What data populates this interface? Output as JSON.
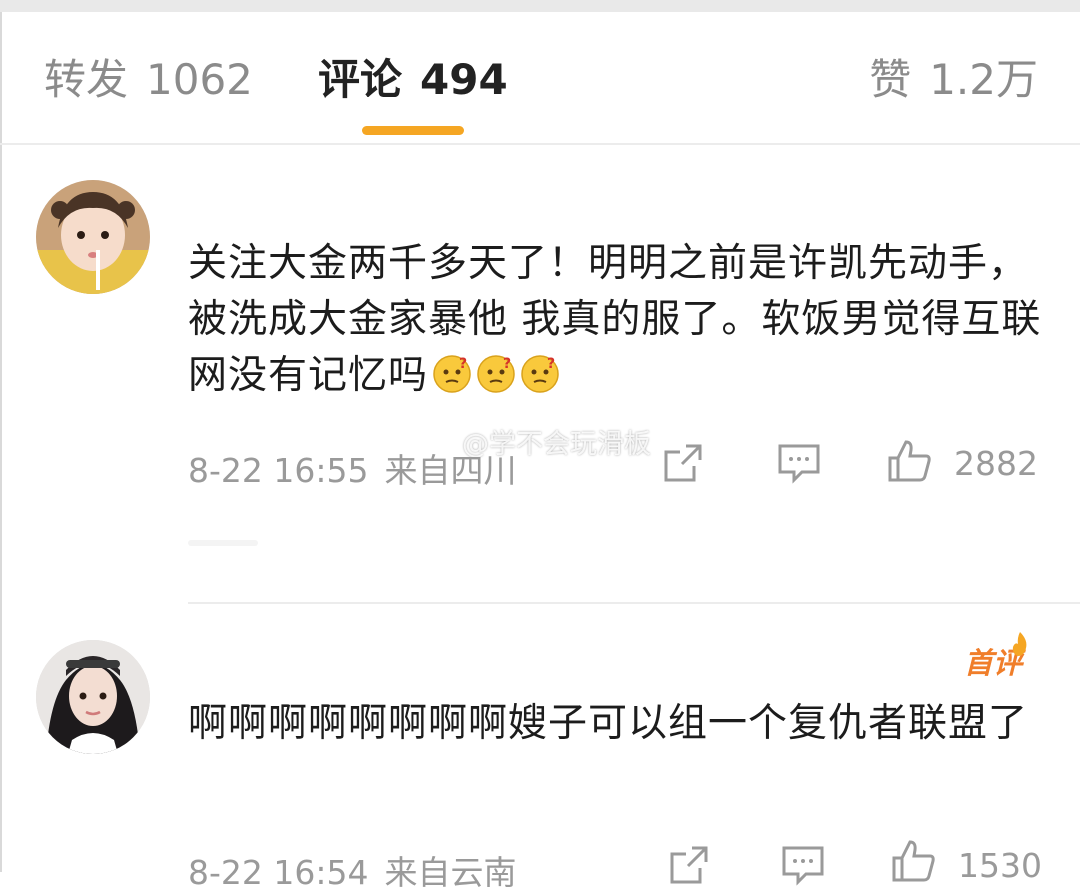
{
  "tabs": {
    "forward": {
      "label": "转发",
      "count": "1062"
    },
    "comments": {
      "label": "评论",
      "count": "494"
    },
    "likes": {
      "label": "赞",
      "count": "1.2万"
    },
    "active": "comments"
  },
  "comments": [
    {
      "text": "关注大金两千多天了！明明之前是许凯先动手，被洗成大金家暴他 我真的服了。软饭男觉得互联网没有记忆吗",
      "emojis": [
        "thinking-emoji",
        "thinking-emoji",
        "thinking-emoji"
      ],
      "time": "8-22 16:55",
      "location": "来自四川",
      "likes": "2882"
    },
    {
      "badge": "首评",
      "text": "啊啊啊啊啊啊啊啊嫂子可以组一个复仇者联盟了",
      "time": "8-22 16:54",
      "location": "来自云南",
      "likes": "1530"
    }
  ],
  "watermark": "@学不会玩滑板",
  "colors": {
    "accent": "#f5a623",
    "muted": "#9a9a9a",
    "badge": "#f07e2a"
  }
}
